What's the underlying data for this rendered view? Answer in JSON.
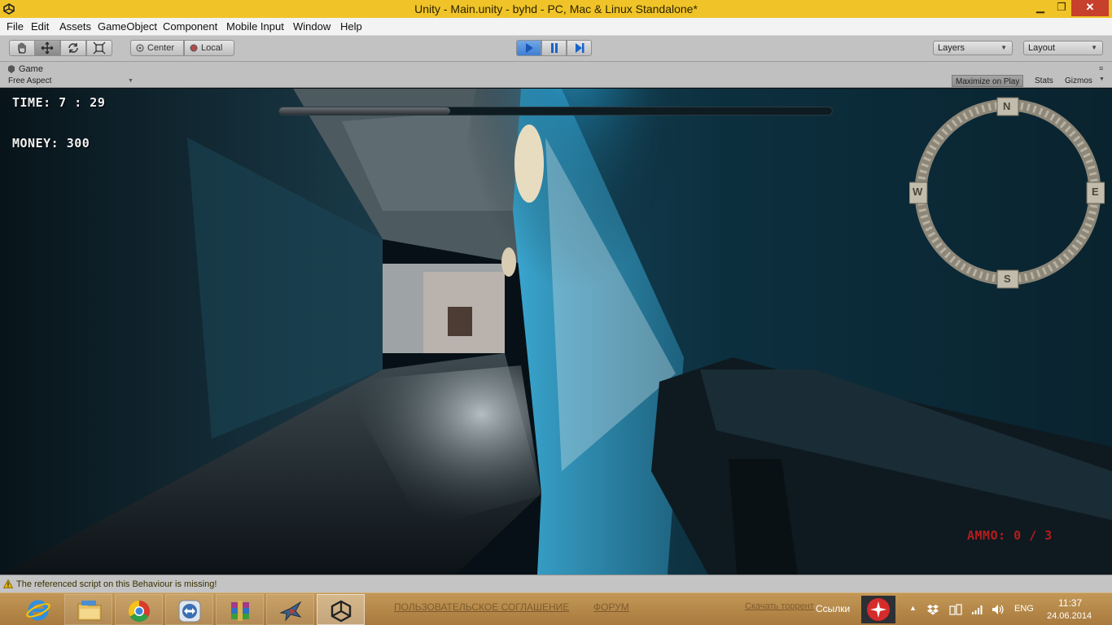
{
  "window": {
    "title": "Unity - Main.unity - byhd - PC, Mac & Linux Standalone*",
    "minimize": "▁",
    "restore": "❐",
    "close": "✕"
  },
  "menu": [
    "File",
    "Edit",
    "Assets",
    "GameObject",
    "Component",
    "Mobile Input",
    "Window",
    "Help"
  ],
  "toolbar": {
    "pivot_center": "Center",
    "pivot_local": "Local",
    "layers": "Layers",
    "layout": "Layout"
  },
  "game_panel": {
    "tab_label": "Game",
    "aspect": "Free Aspect",
    "maximize_on_play": "Maximize on Play",
    "stats": "Stats",
    "gizmos": "Gizmos"
  },
  "hud": {
    "time": "TIME: 7 : 29",
    "money": "MONEY: 300",
    "ammo": "AMMO: 0 / 3",
    "progress": 0.31,
    "compass": {
      "n": "N",
      "e": "E",
      "s": "S",
      "w": "W"
    }
  },
  "status": {
    "message": "The referenced script on this Behaviour is missing!"
  },
  "taskbar": {
    "apps": [
      "internet-explorer",
      "file-explorer",
      "chrome",
      "teamviewer",
      "winrar",
      "game-app",
      "unity"
    ],
    "background_links": [
      "ПОЛЬЗОВАТЕЛЬСКОЕ СОГЛАШЕНИЕ",
      "ФОРУМ",
      "Скачать торрент"
    ],
    "links_label": "Ссылки",
    "language": "ENG",
    "time": "11:37",
    "date": "24.06.2014"
  },
  "colors": {
    "title_bar": "#f0c428",
    "close": "#c7402c",
    "ammo": "#b51d1d",
    "play_active": "#3f7fd1"
  }
}
